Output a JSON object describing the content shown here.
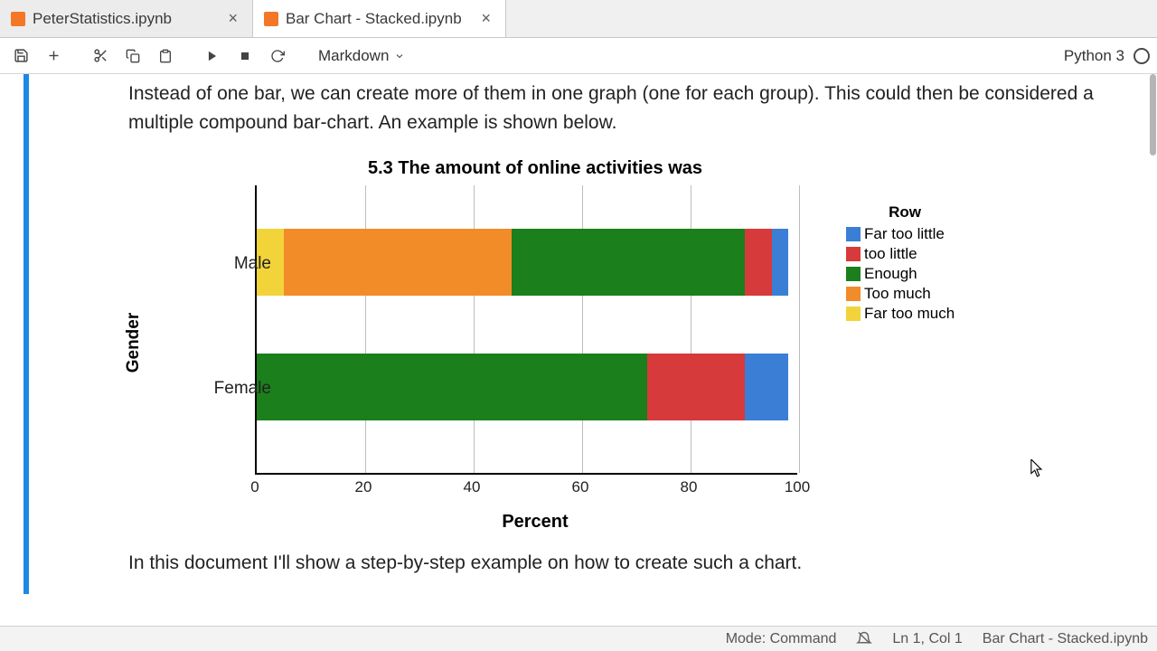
{
  "tabs": [
    {
      "label": "PeterStatistics.ipynb",
      "active": false
    },
    {
      "label": "Bar Chart - Stacked.ipynb",
      "active": true
    }
  ],
  "toolbar": {
    "cell_type": "Markdown",
    "kernel_name": "Python 3"
  },
  "cell": {
    "para1": "Instead of one bar, we can create more of them in one graph (one for each group). This could then be considered a multiple compound bar-chart. An example is shown below.",
    "para2": "In this document I'll show a step-by-step example on how to create such a chart."
  },
  "chart_data": {
    "type": "bar",
    "orientation": "horizontal-stacked",
    "title": "5.3 The amount of online activities was",
    "xlabel": "Percent",
    "ylabel": "Gender",
    "xlim": [
      0,
      100
    ],
    "xticks": [
      0,
      20,
      40,
      60,
      80,
      100
    ],
    "categories": [
      "Male",
      "Female"
    ],
    "legend_title": "Row",
    "series": [
      {
        "name": "Far too little",
        "color": "#3a7fd5",
        "values": [
          3,
          8
        ]
      },
      {
        "name": "too little",
        "color": "#d73a3a",
        "values": [
          5,
          18
        ]
      },
      {
        "name": "Enough",
        "color": "#1b7f1b",
        "values": [
          43,
          72
        ]
      },
      {
        "name": "Too much",
        "color": "#f28c28",
        "values": [
          42,
          0
        ]
      },
      {
        "name": "Far too much",
        "color": "#f2d43a",
        "values": [
          5,
          0
        ]
      }
    ],
    "display_order": [
      "Far too much",
      "Too much",
      "Enough",
      "too little",
      "Far too little"
    ]
  },
  "statusbar": {
    "mode": "Mode: Command",
    "linecol": "Ln 1, Col 1",
    "context": "Bar Chart - Stacked.ipynb"
  },
  "colors": {
    "accent": "#1e88e5",
    "jupyter_orange": "#f37726"
  }
}
